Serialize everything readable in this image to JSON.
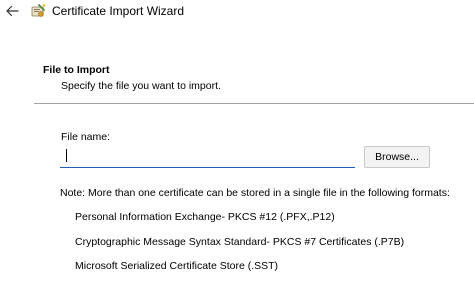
{
  "window": {
    "title": "Certificate Import Wizard",
    "back_icon": "arrow-left-icon",
    "app_icon": "certificate-wizard-icon"
  },
  "section": {
    "heading": "File to Import",
    "subheading": "Specify the file you want to import."
  },
  "file_field": {
    "label": "File name:",
    "value": ""
  },
  "browse_button": {
    "label": "Browse..."
  },
  "note": {
    "text": "Note:  More than one certificate can be stored in a single file in the following formats:",
    "formats": [
      "Personal Information Exchange- PKCS #12 (.PFX,.P12)",
      "Cryptographic Message Syntax Standard- PKCS #7 Certificates (.P7B)",
      "Microsoft Serialized Certificate Store (.SST)"
    ]
  },
  "colors": {
    "focus_underline": "#1a5fb4",
    "separator": "#a0a0a0",
    "button_bg": "#f3f3f3"
  }
}
